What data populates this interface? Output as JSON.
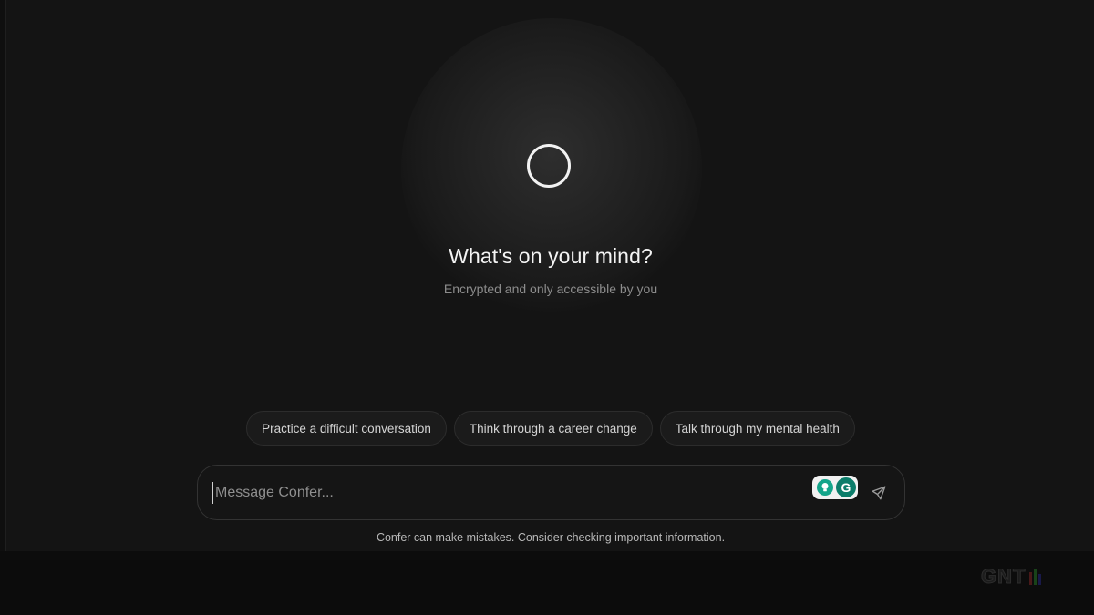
{
  "main": {
    "headline": "What's on your mind?",
    "subheadline": "Encrypted and only accessible by you"
  },
  "suggestions": [
    {
      "label": "Practice a difficult conversation"
    },
    {
      "label": "Think through a career change"
    },
    {
      "label": "Talk through my mental health"
    }
  ],
  "composer": {
    "placeholder": "Message Confer...",
    "value": ""
  },
  "grammarly": {
    "icon": "grammarly-icon",
    "letter": "G",
    "helper_icon": "lightbulb-icon"
  },
  "send": {
    "icon": "send-icon"
  },
  "footer": {
    "disclaimer": "Confer can make mistakes. Consider checking important information."
  },
  "watermark": {
    "text": "GNT"
  },
  "colors": {
    "background": "#141414",
    "grammarly_green": "#14a58a",
    "accent_dark_green": "#0b7d6a"
  }
}
